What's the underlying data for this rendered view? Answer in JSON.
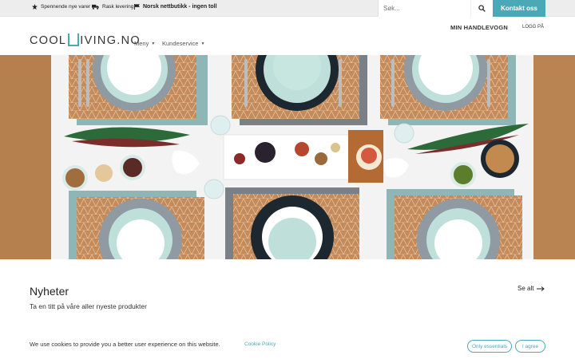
{
  "topbar": {
    "usps": [
      "Spennende nye varer",
      "Rask levering",
      "Norsk nettbutikk - ingen toll"
    ],
    "search_placeholder": "Søk...",
    "contact_label": "Kontakt oss"
  },
  "header": {
    "logo_left": "COOL",
    "logo_right": "IVING.NO",
    "nav": [
      "Meny",
      "Kundeservice"
    ],
    "cart_label": "MIN HANDLEVOGN",
    "login_label": "LOGG PÅ"
  },
  "news": {
    "title": "Nyheter",
    "subtitle": "Ta en titt på våre aller nyeste produkter",
    "see_all": "Se alt"
  },
  "cookie": {
    "text": "We use cookies to provide you a better user experience on this website.",
    "policy_link": "Cookie Policy",
    "essentials_button": "Only essentials",
    "agree_button": "I agree"
  },
  "colors": {
    "accent": "#4aa8b7",
    "topbar_bg": "#ededed"
  }
}
